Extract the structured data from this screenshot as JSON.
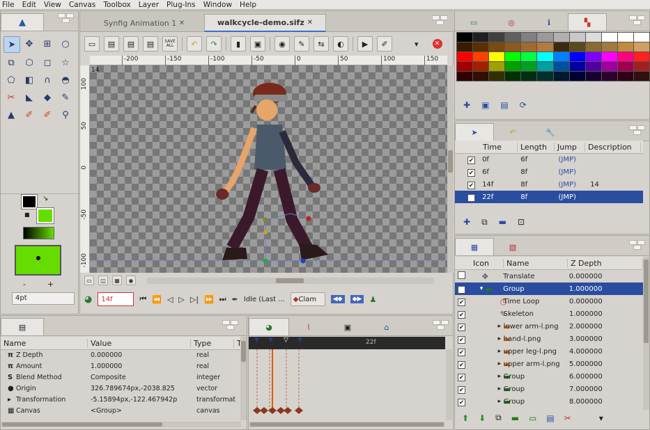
{
  "menu": [
    "File",
    "Edit",
    "View",
    "Canvas",
    "Toolbox",
    "Layer",
    "Plug-Ins",
    "Window",
    "Help"
  ],
  "tabs": [
    {
      "label": "Synfig Animation 1",
      "close": "✕"
    },
    {
      "label": "walkcycle-demo.sifz",
      "close": "✕"
    }
  ],
  "toolbar": {
    "save_all_label": "SAVE ALL"
  },
  "ruler": {
    "h_ticks": [
      "-200",
      "-150",
      "-100",
      "-50",
      "0",
      "50",
      "100",
      "150"
    ],
    "v_ticks": [
      "100",
      "50",
      "0",
      "-50",
      "-100"
    ],
    "frame_badge": "14"
  },
  "playback": {
    "current_frame": "14f",
    "status": "Idle (Last ...",
    "clamp_label": "Clam"
  },
  "width_field": "4pt",
  "width_minus": "-",
  "width_plus": "+",
  "params": {
    "headers": [
      "Name",
      "Value",
      "Type",
      "T"
    ],
    "rows": [
      {
        "icon": "π",
        "name": "Z Depth",
        "value": "0.000000",
        "type": "real"
      },
      {
        "icon": "π",
        "name": "Amount",
        "value": "1.000000",
        "type": "real"
      },
      {
        "icon": "S",
        "name": "Blend Method",
        "value": "Composite",
        "type": "integer"
      },
      {
        "icon": "●",
        "name": "Origin",
        "value": "326.789674px,-2038.825",
        "type": "vector"
      },
      {
        "icon": "▸",
        "name": "Transformation",
        "value": "-5.15894px,-122.467942p",
        "type": "transformat"
      },
      {
        "icon": "▦",
        "name": "Canvas",
        "value": "<Group>",
        "type": "canvas"
      }
    ]
  },
  "timetrack": {
    "label": "22f"
  },
  "palette": {
    "colors": [
      [
        "#000000",
        "#202020",
        "#404040",
        "#606060",
        "#808080",
        "#9a9a9a",
        "#b0b0b0",
        "#c8c8c8",
        "#dcdcdc",
        "#ffffff",
        "#ffffff",
        "#ffffff"
      ],
      [
        "#3a1a00",
        "#5a3000",
        "#7a4a10",
        "#8a5a20",
        "#a06a30",
        "#b07a40",
        "#3a2a10",
        "#5a4a20",
        "#8a6a30",
        "#a07a40",
        "#c08a40",
        "#d0a060"
      ],
      [
        "#ff0000",
        "#ff4000",
        "#ffff00",
        "#00ff00",
        "#00ff40",
        "#00ffff",
        "#0080ff",
        "#0000ff",
        "#8000ff",
        "#ff00ff",
        "#ff0080",
        "#ff2020"
      ],
      [
        "#a00000",
        "#a02000",
        "#a0a000",
        "#00a000",
        "#00a020",
        "#00a0a0",
        "#0050a0",
        "#0000a0",
        "#5000a0",
        "#a000a0",
        "#a00050",
        "#a02020"
      ],
      [
        "#300000",
        "#301000",
        "#303000",
        "#003000",
        "#003010",
        "#003030",
        "#001830",
        "#000030",
        "#180030",
        "#300030",
        "#300018",
        "#301010"
      ]
    ]
  },
  "keyframes": {
    "headers": [
      "Time",
      "Length",
      "Jump",
      "Description"
    ],
    "rows": [
      {
        "time": "0f",
        "length": "6f",
        "jump": "(JMP)",
        "desc": ""
      },
      {
        "time": "6f",
        "length": "8f",
        "jump": "(JMP)",
        "desc": ""
      },
      {
        "time": "14f",
        "length": "8f",
        "jump": "(JMP)",
        "desc": "14"
      },
      {
        "time": "22f",
        "length": "8f",
        "jump": "(JMP)",
        "desc": ""
      }
    ]
  },
  "layers": {
    "headers": [
      "Icon",
      "Name",
      "Z Depth"
    ],
    "rows": [
      {
        "icon": "✥",
        "name": "Translate",
        "z": "0.000000",
        "exp": "",
        "checked": false,
        "sel": false,
        "indent": 0
      },
      {
        "icon": "▬",
        "name": "Group",
        "z": "1.000000",
        "exp": "▾",
        "checked": true,
        "sel": true,
        "indent": 0
      },
      {
        "icon": "◷",
        "name": "Time Loop",
        "z": "0.000000",
        "exp": "",
        "checked": true,
        "sel": false,
        "indent": 1
      },
      {
        "icon": "✎",
        "name": "Skeleton",
        "z": "1.000000",
        "exp": "",
        "checked": true,
        "sel": false,
        "indent": 1
      },
      {
        "icon": "▬",
        "name": "lower arm-l.png",
        "z": "2.000000",
        "exp": "▸",
        "checked": true,
        "sel": false,
        "indent": 1
      },
      {
        "icon": "▬",
        "name": "hand-l.png",
        "z": "3.000000",
        "exp": "▸",
        "checked": true,
        "sel": false,
        "indent": 1
      },
      {
        "icon": "▬",
        "name": "upper leg-l.png",
        "z": "4.000000",
        "exp": "▸",
        "checked": true,
        "sel": false,
        "indent": 1
      },
      {
        "icon": "▬",
        "name": "upper arm-l.png",
        "z": "5.000000",
        "exp": "▸",
        "checked": true,
        "sel": false,
        "indent": 1
      },
      {
        "icon": "▬",
        "name": "Group",
        "z": "6.000000",
        "exp": "▸",
        "checked": true,
        "sel": false,
        "indent": 1
      },
      {
        "icon": "▬",
        "name": "Group",
        "z": "7.000000",
        "exp": "▸",
        "checked": true,
        "sel": false,
        "indent": 1
      },
      {
        "icon": "▬",
        "name": "Group",
        "z": "8.000000",
        "exp": "▸",
        "checked": true,
        "sel": false,
        "indent": 1
      }
    ]
  },
  "colors": {
    "accent": "#2a4da0",
    "fill": "#66dd00",
    "outline": "#000000",
    "layer_icon": "#e06a10",
    "group_icon": "#1f7a1f"
  }
}
